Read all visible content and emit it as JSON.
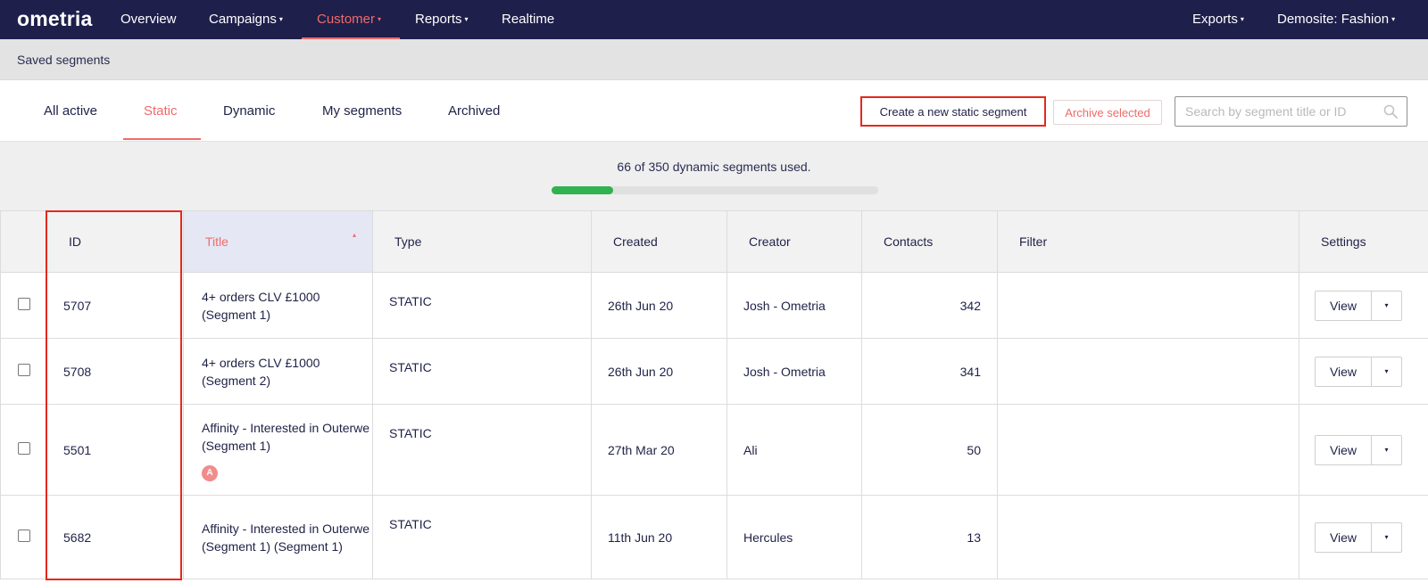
{
  "nav": {
    "logo": "ometria",
    "items": [
      {
        "label": "Overview",
        "dropdown": false
      },
      {
        "label": "Campaigns",
        "dropdown": true
      },
      {
        "label": "Customer",
        "dropdown": true,
        "active": true
      },
      {
        "label": "Reports",
        "dropdown": true
      },
      {
        "label": "Realtime",
        "dropdown": false
      }
    ],
    "right": [
      {
        "label": "Exports",
        "dropdown": true
      },
      {
        "label": "Demosite: Fashion",
        "dropdown": true
      }
    ],
    "caret": "▾"
  },
  "subheader": {
    "title": "Saved segments"
  },
  "tabs": [
    {
      "label": "All active"
    },
    {
      "label": "Static",
      "active": true
    },
    {
      "label": "Dynamic"
    },
    {
      "label": "My segments"
    },
    {
      "label": "Archived"
    }
  ],
  "actions": {
    "create_label": "Create a new static segment",
    "archive_label": "Archive selected",
    "search_placeholder": "Search by segment title or ID"
  },
  "usage": {
    "text": "66 of 350 dynamic segments used.",
    "used": 66,
    "total": 350
  },
  "table": {
    "columns": [
      "ID",
      "Title",
      "Type",
      "Created",
      "Creator",
      "Contacts",
      "Filter",
      "Settings"
    ],
    "sort_caret": "▴",
    "rows": [
      {
        "id": "5707",
        "title": "4+ orders CLV £1000 (Segment 1)",
        "type": "STATIC",
        "created": "26th Jun 20",
        "creator": "Josh - Ometria",
        "contacts": "342",
        "filter": "",
        "badge": ""
      },
      {
        "id": "5708",
        "title": "4+ orders CLV £1000 (Segment 2)",
        "type": "STATIC",
        "created": "26th Jun 20",
        "creator": "Josh - Ometria",
        "contacts": "341",
        "filter": "",
        "badge": ""
      },
      {
        "id": "5501",
        "title": "Affinity - Interested in Outerwe (Segment 1)",
        "type": "STATIC",
        "created": "27th Mar 20",
        "creator": "Ali ",
        "contacts": "50",
        "filter": "",
        "badge": "A"
      },
      {
        "id": "5682",
        "title": "Affinity - Interested in Outerwe (Segment 1) (Segment 1)",
        "type": "STATIC",
        "created": "11th Jun 20",
        "creator": "Hercules ",
        "contacts": "13",
        "filter": "",
        "badge": ""
      }
    ],
    "view_label": "View",
    "drop_caret": "▾"
  },
  "colors": {
    "nav_bg": "#1e1f4b",
    "accent": "#f06a6a",
    "highlight": "#e4291c",
    "progress": "#2fb24f"
  }
}
